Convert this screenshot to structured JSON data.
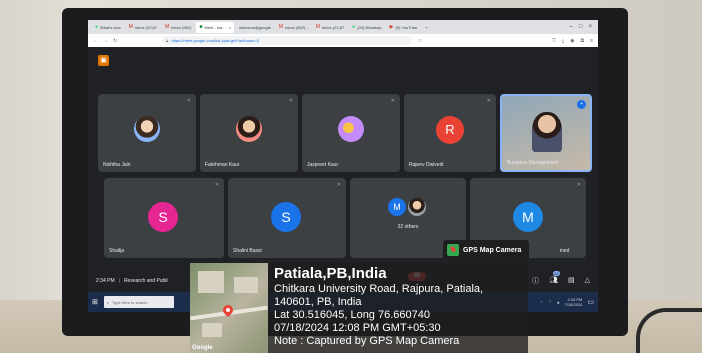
{
  "browser": {
    "tabs": [
      {
        "label": "What's new",
        "icon": "whatsapp-icon"
      },
      {
        "label": "Inbox (22,87",
        "icon": "gmail-icon"
      },
      {
        "label": "Inbox (962)",
        "icon": "gmail-icon"
      },
      {
        "label": "Meet - kid-...",
        "icon": "meet-icon",
        "active": true
      },
      {
        "label": "welcome@google",
        "icon": ""
      },
      {
        "label": "Inbox (962) -",
        "icon": "gmail-icon"
      },
      {
        "label": "Inbox (22,87",
        "icon": "gmail-icon"
      },
      {
        "label": "(20) WhatsAp",
        "icon": "whatsapp-icon"
      },
      {
        "label": "(9) YouTube",
        "icon": "youtube-icon"
      }
    ],
    "new_tab": "+",
    "url": "https://meet.google.com/kid-zjaw-grb?authuser=2"
  },
  "meet": {
    "participants": [
      {
        "name": "Nishtha Jain",
        "type": "photo",
        "color": "#8ab4f8"
      },
      {
        "name": "Fatehman Kaur",
        "type": "photo",
        "color": "#f28b82"
      },
      {
        "name": "Jaspreet Kaur",
        "type": "photo",
        "color": "#c58af9"
      },
      {
        "name": "Rajeev Dwivedi",
        "type": "letter",
        "letter": "R",
        "color": "#ea4335"
      },
      {
        "name": "Business Management",
        "type": "video"
      },
      {
        "name": "Shailja",
        "type": "letter",
        "letter": "S",
        "color": "#e52592"
      },
      {
        "name": "Shalini Bassi",
        "type": "letter",
        "letter": "S",
        "color": "#1a73e8"
      },
      {
        "name": "22 others",
        "type": "others",
        "letter": "M",
        "color": "#1a73e8"
      },
      {
        "name": "",
        "type": "letter",
        "letter": "M",
        "color": "#1e88e5"
      }
    ],
    "partial_name": "ined",
    "time": "2:34 PM",
    "meeting_title": "Research and Publi",
    "participant_count": "83"
  },
  "taskbar": {
    "search_placeholder": "Type here to search",
    "clock_time": "2:34 PM",
    "clock_date": "7/18/2024"
  },
  "gps": {
    "app_label": "GPS Map Camera",
    "map_label": "Google",
    "place": "Patiala,PB,India",
    "address_line1": "Chitkara University Road, Rajpura, Patiala,",
    "address_line2": "140601, PB, India",
    "coords": "Lat 30.516045, Long 76.660740",
    "datetime": "07/18/2024 12:08 PM GMT+05:30",
    "note": "Note : Captured by GPS Map Camera"
  }
}
